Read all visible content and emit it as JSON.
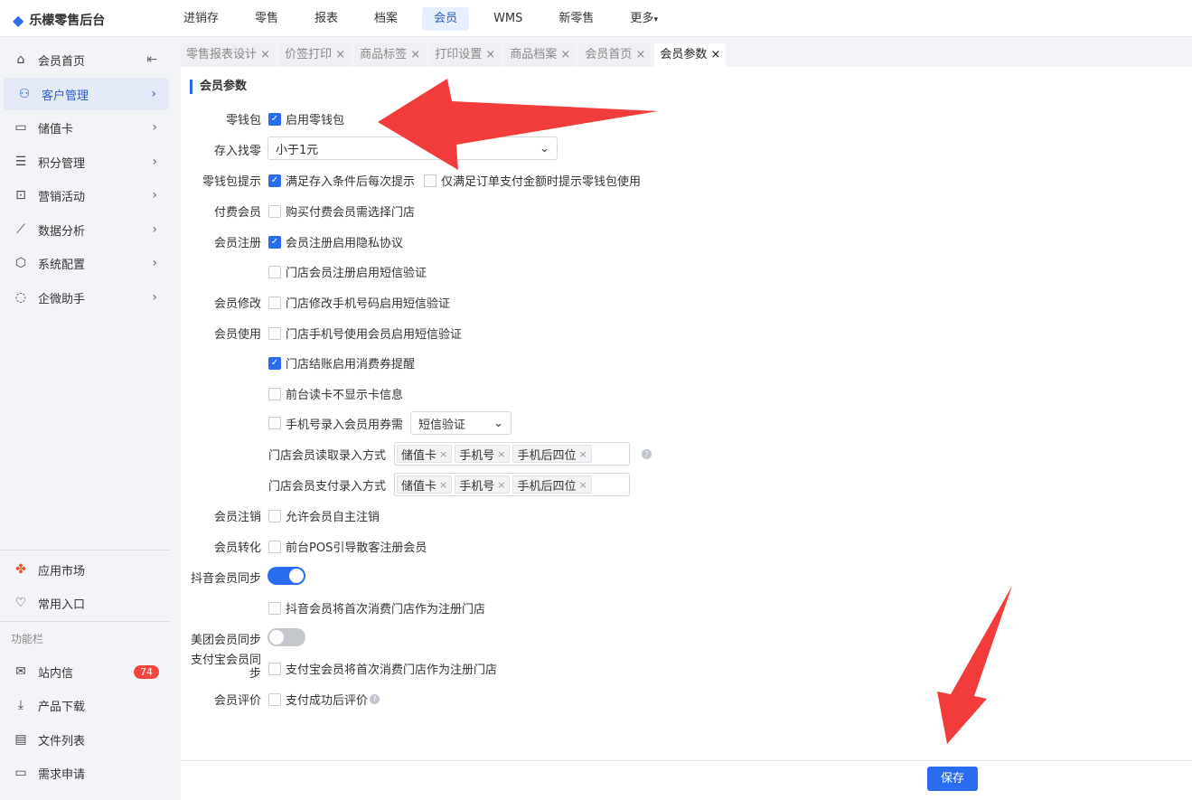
{
  "app": {
    "title": "乐檬零售后台"
  },
  "nav": [
    "进销存",
    "零售",
    "报表",
    "档案",
    "会员",
    "WMS",
    "新零售",
    "更多"
  ],
  "sidebar": {
    "items": [
      "会员首页",
      "客户管理",
      "储值卡",
      "积分管理",
      "营销活动",
      "数据分析",
      "系统配置",
      "企微助手"
    ],
    "bottom": [
      "应用市场",
      "常用入口"
    ],
    "section": "功能栏",
    "tools": [
      "站内信",
      "产品下载",
      "文件列表",
      "需求申请"
    ],
    "msg_count": "74"
  },
  "tabs": [
    "零售报表设计",
    "价签打印",
    "商品标签",
    "打印设置",
    "商品档案",
    "会员首页",
    "会员参数"
  ],
  "page": {
    "title": "会员参数",
    "labels": {
      "wallet": "零钱包",
      "deposit": "存入找零",
      "wallet_tip": "零钱包提示",
      "paid": "付费会员",
      "register": "会员注册",
      "modify": "会员修改",
      "use": "会员使用",
      "cancel": "会员注销",
      "convert": "会员转化",
      "douyin": "抖音会员同步",
      "meituan": "美团会员同步",
      "alipay": "支付宝会员同步",
      "review": "会员评价"
    },
    "options": {
      "wallet_enable": "启用零钱包",
      "deposit_value": "小于1元",
      "tip1": "满足存入条件后每次提示",
      "tip2": "仅满足订单支付金额时提示零钱包使用",
      "paid_store": "购买付费会员需选择门店",
      "reg_privacy": "会员注册启用隐私协议",
      "reg_sms": "门店会员注册启用短信验证",
      "mod_sms": "门店修改手机号码启用短信验证",
      "use_sms": "门店手机号使用会员启用短信验证",
      "use_coupon": "门店结账启用消费券提醒",
      "use_hide": "前台读卡不显示卡信息",
      "use_phone": "手机号录入会员用券需",
      "use_phone_value": "短信验证",
      "read_mode": "门店会员读取录入方式",
      "pay_mode": "门店会员支付录入方式",
      "self_cancel": "允许会员自主注销",
      "pos_guide": "前台POS引导散客注册会员",
      "douyin_store": "抖音会员将首次消费门店作为注册门店",
      "alipay_store": "支付宝会员将首次消费门店作为注册门店",
      "review_after": "支付成功后评价"
    },
    "tags": [
      "储值卡",
      "手机号",
      "手机后四位"
    ],
    "save": "保存"
  },
  "colors": {
    "accent": "#2a6cf0",
    "arrow": "#f23c3c"
  }
}
